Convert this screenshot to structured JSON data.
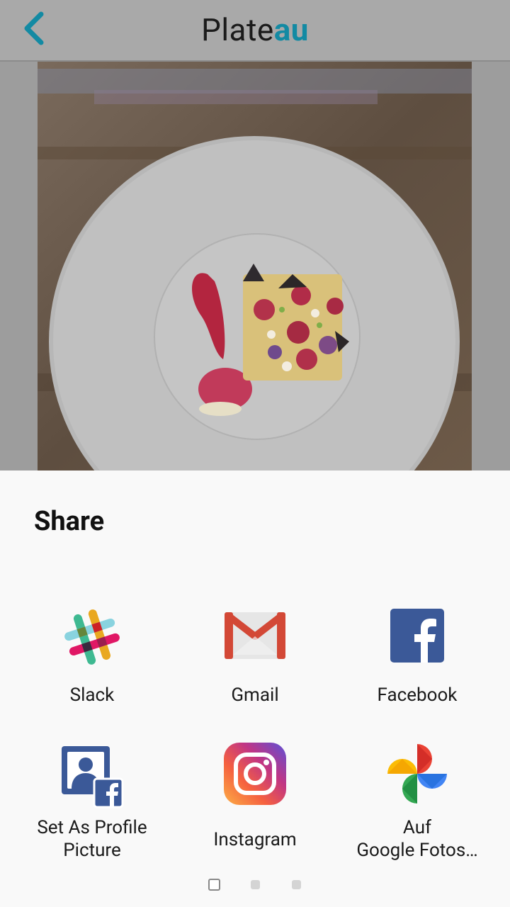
{
  "header": {
    "logo_text": "Plate",
    "logo_accent": "au",
    "back_icon": "chevron-left-icon"
  },
  "photo": {
    "description_icon": "dessert-plate-photo"
  },
  "share_sheet": {
    "title": "Share",
    "apps": [
      {
        "label": "Slack",
        "icon": "slack-icon"
      },
      {
        "label": "Gmail",
        "icon": "gmail-icon"
      },
      {
        "label": "Facebook",
        "icon": "facebook-icon"
      },
      {
        "label_line1": "Set As Profile",
        "label_line2": "Picture",
        "icon": "facebook-profile-picture-icon"
      },
      {
        "label": "Instagram",
        "icon": "instagram-icon"
      },
      {
        "label_line1": "Auf",
        "label_line2": "Google Fotos…",
        "icon": "google-photos-icon"
      }
    ],
    "pager": {
      "pages": 3,
      "current": 1
    }
  },
  "colors": {
    "accent": "#138aa3",
    "sheet_bg": "#f9f9f9",
    "topbar_bg": "#a9a9a9"
  }
}
